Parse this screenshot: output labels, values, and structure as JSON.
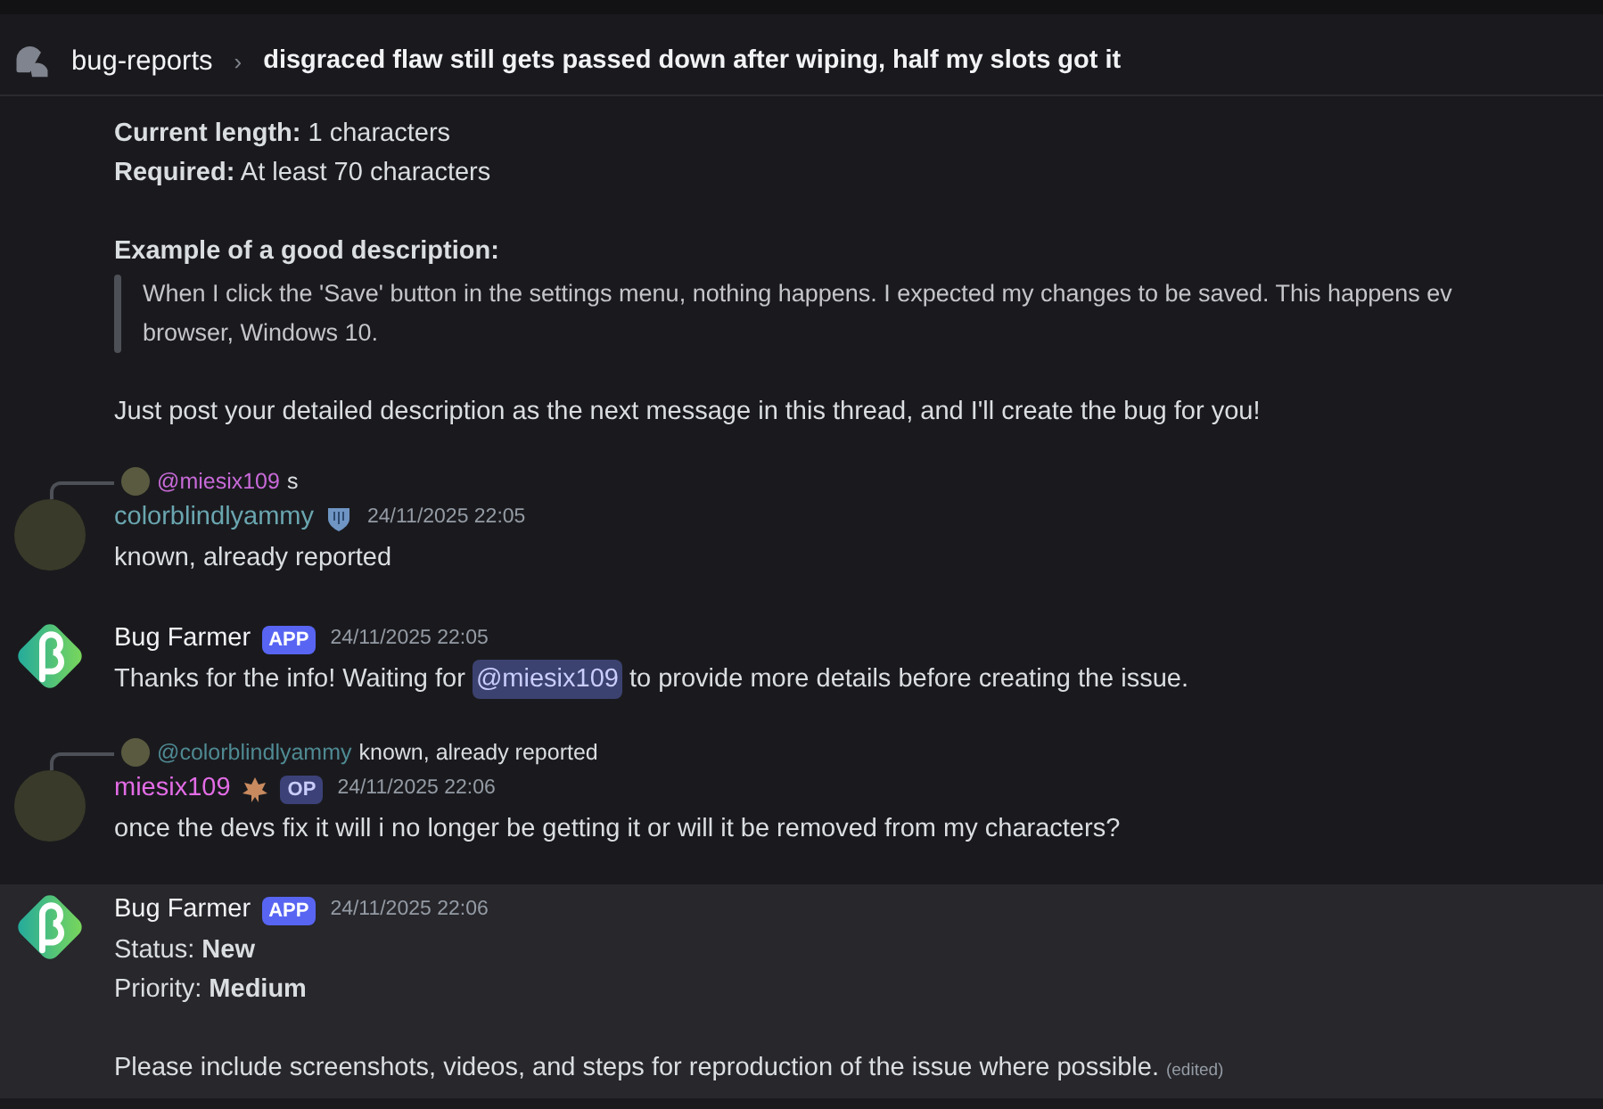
{
  "header": {
    "channel": "bug-reports",
    "separator": "›",
    "thread": "disgraced flaw still gets passed down after wiping, half my slots got it"
  },
  "messages": [
    {
      "kind": "continuation",
      "highlighted": false,
      "lines": [
        "**Current length:** 1 characters",
        "**Required:** At least 70 characters"
      ],
      "heading": "Example of a good description:",
      "quote": [
        "When I click the 'Save' button in the settings menu, nothing happens. I expected my changes to be saved. This happens ev",
        "browser, Windows 10."
      ],
      "after": "Just post your detailed description as the next message in this thread, and I'll create the bug for you!"
    },
    {
      "kind": "message",
      "highlighted": false,
      "avatar": {
        "kind": "person"
      },
      "reply": {
        "author": "@miesix109",
        "color": "#c86ad8",
        "text": "s"
      },
      "author": "colorblindlyammy",
      "color": "#6aa6b0",
      "badge": {
        "kind": "shield"
      },
      "time": "24/11/2025 22:05",
      "lines": [
        "known, already reported"
      ]
    },
    {
      "kind": "message",
      "highlighted": false,
      "avatar": {
        "kind": "bot"
      },
      "author": "Bug Farmer",
      "color": "#f2f3f5",
      "tag": "APP",
      "time": "24/11/2025 22:05",
      "lines": [
        "Thanks for the info! Waiting for "
      ],
      "mention": "@miesix109",
      "mention_after": " to provide more details before creating the issue."
    },
    {
      "kind": "message",
      "highlighted": false,
      "avatar": {
        "kind": "person"
      },
      "reply": {
        "author": "@colorblindlyammy",
        "color": "#4f8a93",
        "text": "known, already reported"
      },
      "author": "miesix109",
      "color": "#e36ce6",
      "badge": {
        "kind": "leaf"
      },
      "tag": "OP",
      "time": "24/11/2025 22:06",
      "lines": [
        "once the devs fix it will i no longer be getting it or will it be removed from my characters?"
      ]
    },
    {
      "kind": "message",
      "highlighted": true,
      "avatar": {
        "kind": "bot"
      },
      "author": "Bug Farmer",
      "color": "#f2f3f5",
      "tag": "APP",
      "time": "24/11/2025 22:06",
      "lines": [
        "Status: **New**",
        "Priority: **Medium**"
      ],
      "last": "Please include screenshots, videos, and steps for reproduction of the issue where possible.",
      "edited": "(edited)"
    }
  ]
}
